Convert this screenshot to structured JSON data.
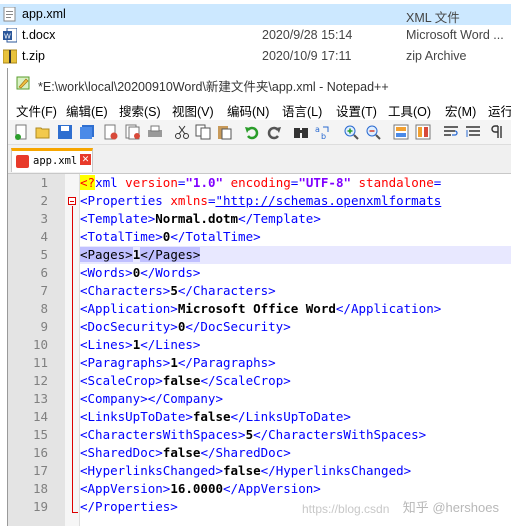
{
  "explorer": {
    "files": [
      {
        "name": "app.xml",
        "date": "",
        "type": "XML 文件",
        "icon": "xml-file-icon",
        "selected": true
      },
      {
        "name": "t.docx",
        "date": "2020/9/28 15:14",
        "type": "Microsoft Word ...",
        "icon": "word-file-icon",
        "selected": false
      },
      {
        "name": "t.zip",
        "date": "2020/10/9 17:11",
        "type": "zip Archive",
        "icon": "zip-file-icon",
        "selected": false
      }
    ]
  },
  "window": {
    "title": "*E:\\work\\local\\20200910Word\\新建文件夹\\app.xml - Notepad++"
  },
  "menu": [
    "文件(F)",
    "编辑(E)",
    "搜索(S)",
    "视图(V)",
    "编码(N)",
    "语言(L)",
    "设置(T)",
    "工具(O)",
    "宏(M)",
    "运行"
  ],
  "tab": {
    "label": "app.xml"
  },
  "lines": [
    {
      "n": "1",
      "parts": [
        [
          "pi",
          "<?"
        ],
        [
          "tag",
          "xml "
        ],
        [
          "attr",
          "version"
        ],
        [
          "tag",
          "="
        ],
        [
          "val",
          "\"1.0\""
        ],
        [
          "tag",
          " "
        ],
        [
          "attr",
          "encoding"
        ],
        [
          "tag",
          "="
        ],
        [
          "val",
          "\"UTF-8\""
        ],
        [
          "tag",
          " "
        ],
        [
          "attr",
          "standalone"
        ],
        [
          "tag",
          "="
        ]
      ]
    },
    {
      "n": "2",
      "parts": [
        [
          "tag",
          "<Properties "
        ],
        [
          "attr",
          "xmlns"
        ],
        [
          "tag",
          "="
        ],
        [
          "lnk",
          "\"http://schemas.openxmlformats"
        ]
      ]
    },
    {
      "n": "3",
      "parts": [
        [
          "tag",
          "<Template>"
        ],
        [
          "txt",
          "Normal.dotm"
        ],
        [
          "tag",
          "</Template>"
        ]
      ]
    },
    {
      "n": "4",
      "parts": [
        [
          "tag",
          "<TotalTime>"
        ],
        [
          "txt",
          "0"
        ],
        [
          "tag",
          "</TotalTime>"
        ]
      ]
    },
    {
      "n": "5",
      "parts": [
        [
          "hl",
          "<Pages>"
        ],
        [
          "txt",
          "1"
        ],
        [
          "hl",
          "</Pages>"
        ]
      ],
      "current": true
    },
    {
      "n": "6",
      "parts": [
        [
          "tag",
          "<Words>"
        ],
        [
          "txt",
          "0"
        ],
        [
          "tag",
          "</Words>"
        ]
      ]
    },
    {
      "n": "7",
      "parts": [
        [
          "tag",
          "<Characters>"
        ],
        [
          "txt",
          "5"
        ],
        [
          "tag",
          "</Characters>"
        ]
      ]
    },
    {
      "n": "8",
      "parts": [
        [
          "tag",
          "<Application>"
        ],
        [
          "txt",
          "Microsoft Office Word"
        ],
        [
          "tag",
          "</Application>"
        ]
      ]
    },
    {
      "n": "9",
      "parts": [
        [
          "tag",
          "<DocSecurity>"
        ],
        [
          "txt",
          "0"
        ],
        [
          "tag",
          "</DocSecurity>"
        ]
      ]
    },
    {
      "n": "10",
      "parts": [
        [
          "tag",
          "<Lines>"
        ],
        [
          "txt",
          "1"
        ],
        [
          "tag",
          "</Lines>"
        ]
      ]
    },
    {
      "n": "11",
      "parts": [
        [
          "tag",
          "<Paragraphs>"
        ],
        [
          "txt",
          "1"
        ],
        [
          "tag",
          "</Paragraphs>"
        ]
      ]
    },
    {
      "n": "12",
      "parts": [
        [
          "tag",
          "<ScaleCrop>"
        ],
        [
          "txt",
          "false"
        ],
        [
          "tag",
          "</ScaleCrop>"
        ]
      ]
    },
    {
      "n": "13",
      "parts": [
        [
          "tag",
          "<Company></Company>"
        ]
      ]
    },
    {
      "n": "14",
      "parts": [
        [
          "tag",
          "<LinksUpToDate>"
        ],
        [
          "txt",
          "false"
        ],
        [
          "tag",
          "</LinksUpToDate>"
        ]
      ]
    },
    {
      "n": "15",
      "parts": [
        [
          "tag",
          "<CharactersWithSpaces>"
        ],
        [
          "txt",
          "5"
        ],
        [
          "tag",
          "</CharactersWithSpaces>"
        ]
      ]
    },
    {
      "n": "16",
      "parts": [
        [
          "tag",
          "<SharedDoc>"
        ],
        [
          "txt",
          "false"
        ],
        [
          "tag",
          "</SharedDoc>"
        ]
      ]
    },
    {
      "n": "17",
      "parts": [
        [
          "tag",
          "<HyperlinksChanged>"
        ],
        [
          "txt",
          "false"
        ],
        [
          "tag",
          "</HyperlinksChanged>"
        ]
      ]
    },
    {
      "n": "18",
      "parts": [
        [
          "tag",
          "<AppVersion>"
        ],
        [
          "txt",
          "16.0000"
        ],
        [
          "tag",
          "</AppVersion>"
        ]
      ]
    },
    {
      "n": "19",
      "parts": [
        [
          "tag",
          "</Properties>"
        ]
      ]
    }
  ],
  "watermark": {
    "text": "知乎 @hershoes",
    "url_text": "https://blog.csdn"
  },
  "colors": {
    "tag": "#0000ff",
    "attr": "#ff0000",
    "value": "#8000ff",
    "selection": "#cce8ff",
    "tab_accent": "#f7a600"
  }
}
